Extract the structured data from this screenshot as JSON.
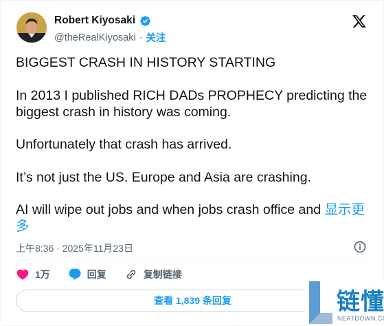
{
  "author": {
    "name": "Robert Kiyosaki",
    "handle": "@theRealKiyosaki",
    "follow_label": "关注"
  },
  "tweet": {
    "paragraphs": [
      "BIGGEST CRASH IN HISTORY STARTING",
      "In 2013 I published RICH DADs PROPHECY predicting the biggest crash in history was coming.",
      "Unfortunately that crash has arrived.",
      "It’s not just the US.  Europe and Asia are crashing.",
      "AI will wipe out jobs and when jobs crash office and "
    ],
    "show_more_label": "显示更多"
  },
  "meta": {
    "timestamp": "上午8:36 · 2025年11月23日"
  },
  "actions": {
    "likes_count": "1万",
    "reply_label": "回复",
    "copy_link_label": "复制链接"
  },
  "replies_button_label": "查看 1,839 条回复",
  "watermark": {
    "logo_text": "链懂",
    "sub_text": "NEATDOWN.COM"
  },
  "colors": {
    "accent": "#1d9bf0",
    "like": "#f91880",
    "text": "#0f1419",
    "muted": "#536471"
  },
  "icons": [
    "verified-badge-icon",
    "x-logo-icon",
    "info-icon",
    "heart-icon",
    "reply-bubble-icon",
    "link-icon"
  ]
}
